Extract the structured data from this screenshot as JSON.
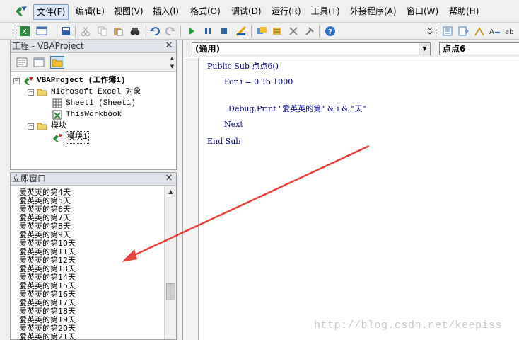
{
  "menubar": {
    "items": [
      {
        "label": "文件(F)",
        "active": true
      },
      {
        "label": "编辑(E)"
      },
      {
        "label": "视图(V)"
      },
      {
        "label": "插入(I)"
      },
      {
        "label": "格式(O)"
      },
      {
        "label": "调试(D)"
      },
      {
        "label": "运行(R)"
      },
      {
        "label": "工具(T)"
      },
      {
        "label": "外接程序(A)"
      },
      {
        "label": "窗口(W)"
      },
      {
        "label": "帮助(H)"
      }
    ]
  },
  "project": {
    "title": "工程 - VBAProject",
    "tree": [
      {
        "label": "VBAProject (工作簿1)"
      },
      {
        "label": "Microsoft Excel 对象"
      },
      {
        "label": "Sheet1 (Sheet1)"
      },
      {
        "label": "ThisWorkbook"
      },
      {
        "label": "模块"
      },
      {
        "label": "模块1"
      }
    ]
  },
  "immediate": {
    "title": "立即窗口",
    "lines": [
      "爱英英的第4天",
      "爱英英的第5天",
      "爱英英的第6天",
      "爱英英的第7天",
      "爱英英的第8天",
      "爱英英的第9天",
      "爱英英的第10天",
      "爱英英的第11天",
      "爱英英的第12天",
      "爱英英的第13天",
      "爱英英的第14天",
      "爱英英的第15天",
      "爱英英的第16天",
      "爱英英的第17天",
      "爱英英的第18天",
      "爱英英的第19天",
      "爱英英的第20天",
      "爱英英的第21天"
    ]
  },
  "code": {
    "object_combo": "(通用)",
    "proc_combo": "点点6",
    "lines": [
      "Public Sub 点点6()",
      "For i = 0 To 1000",
      "Debug.Print \"爱英英的第\" & i & \"天\"",
      "Next",
      "End Sub"
    ]
  },
  "watermark": "http://blog.csdn.net/keepiss",
  "colors": {
    "arrow": "#e8403a",
    "code_text": "#000080"
  }
}
